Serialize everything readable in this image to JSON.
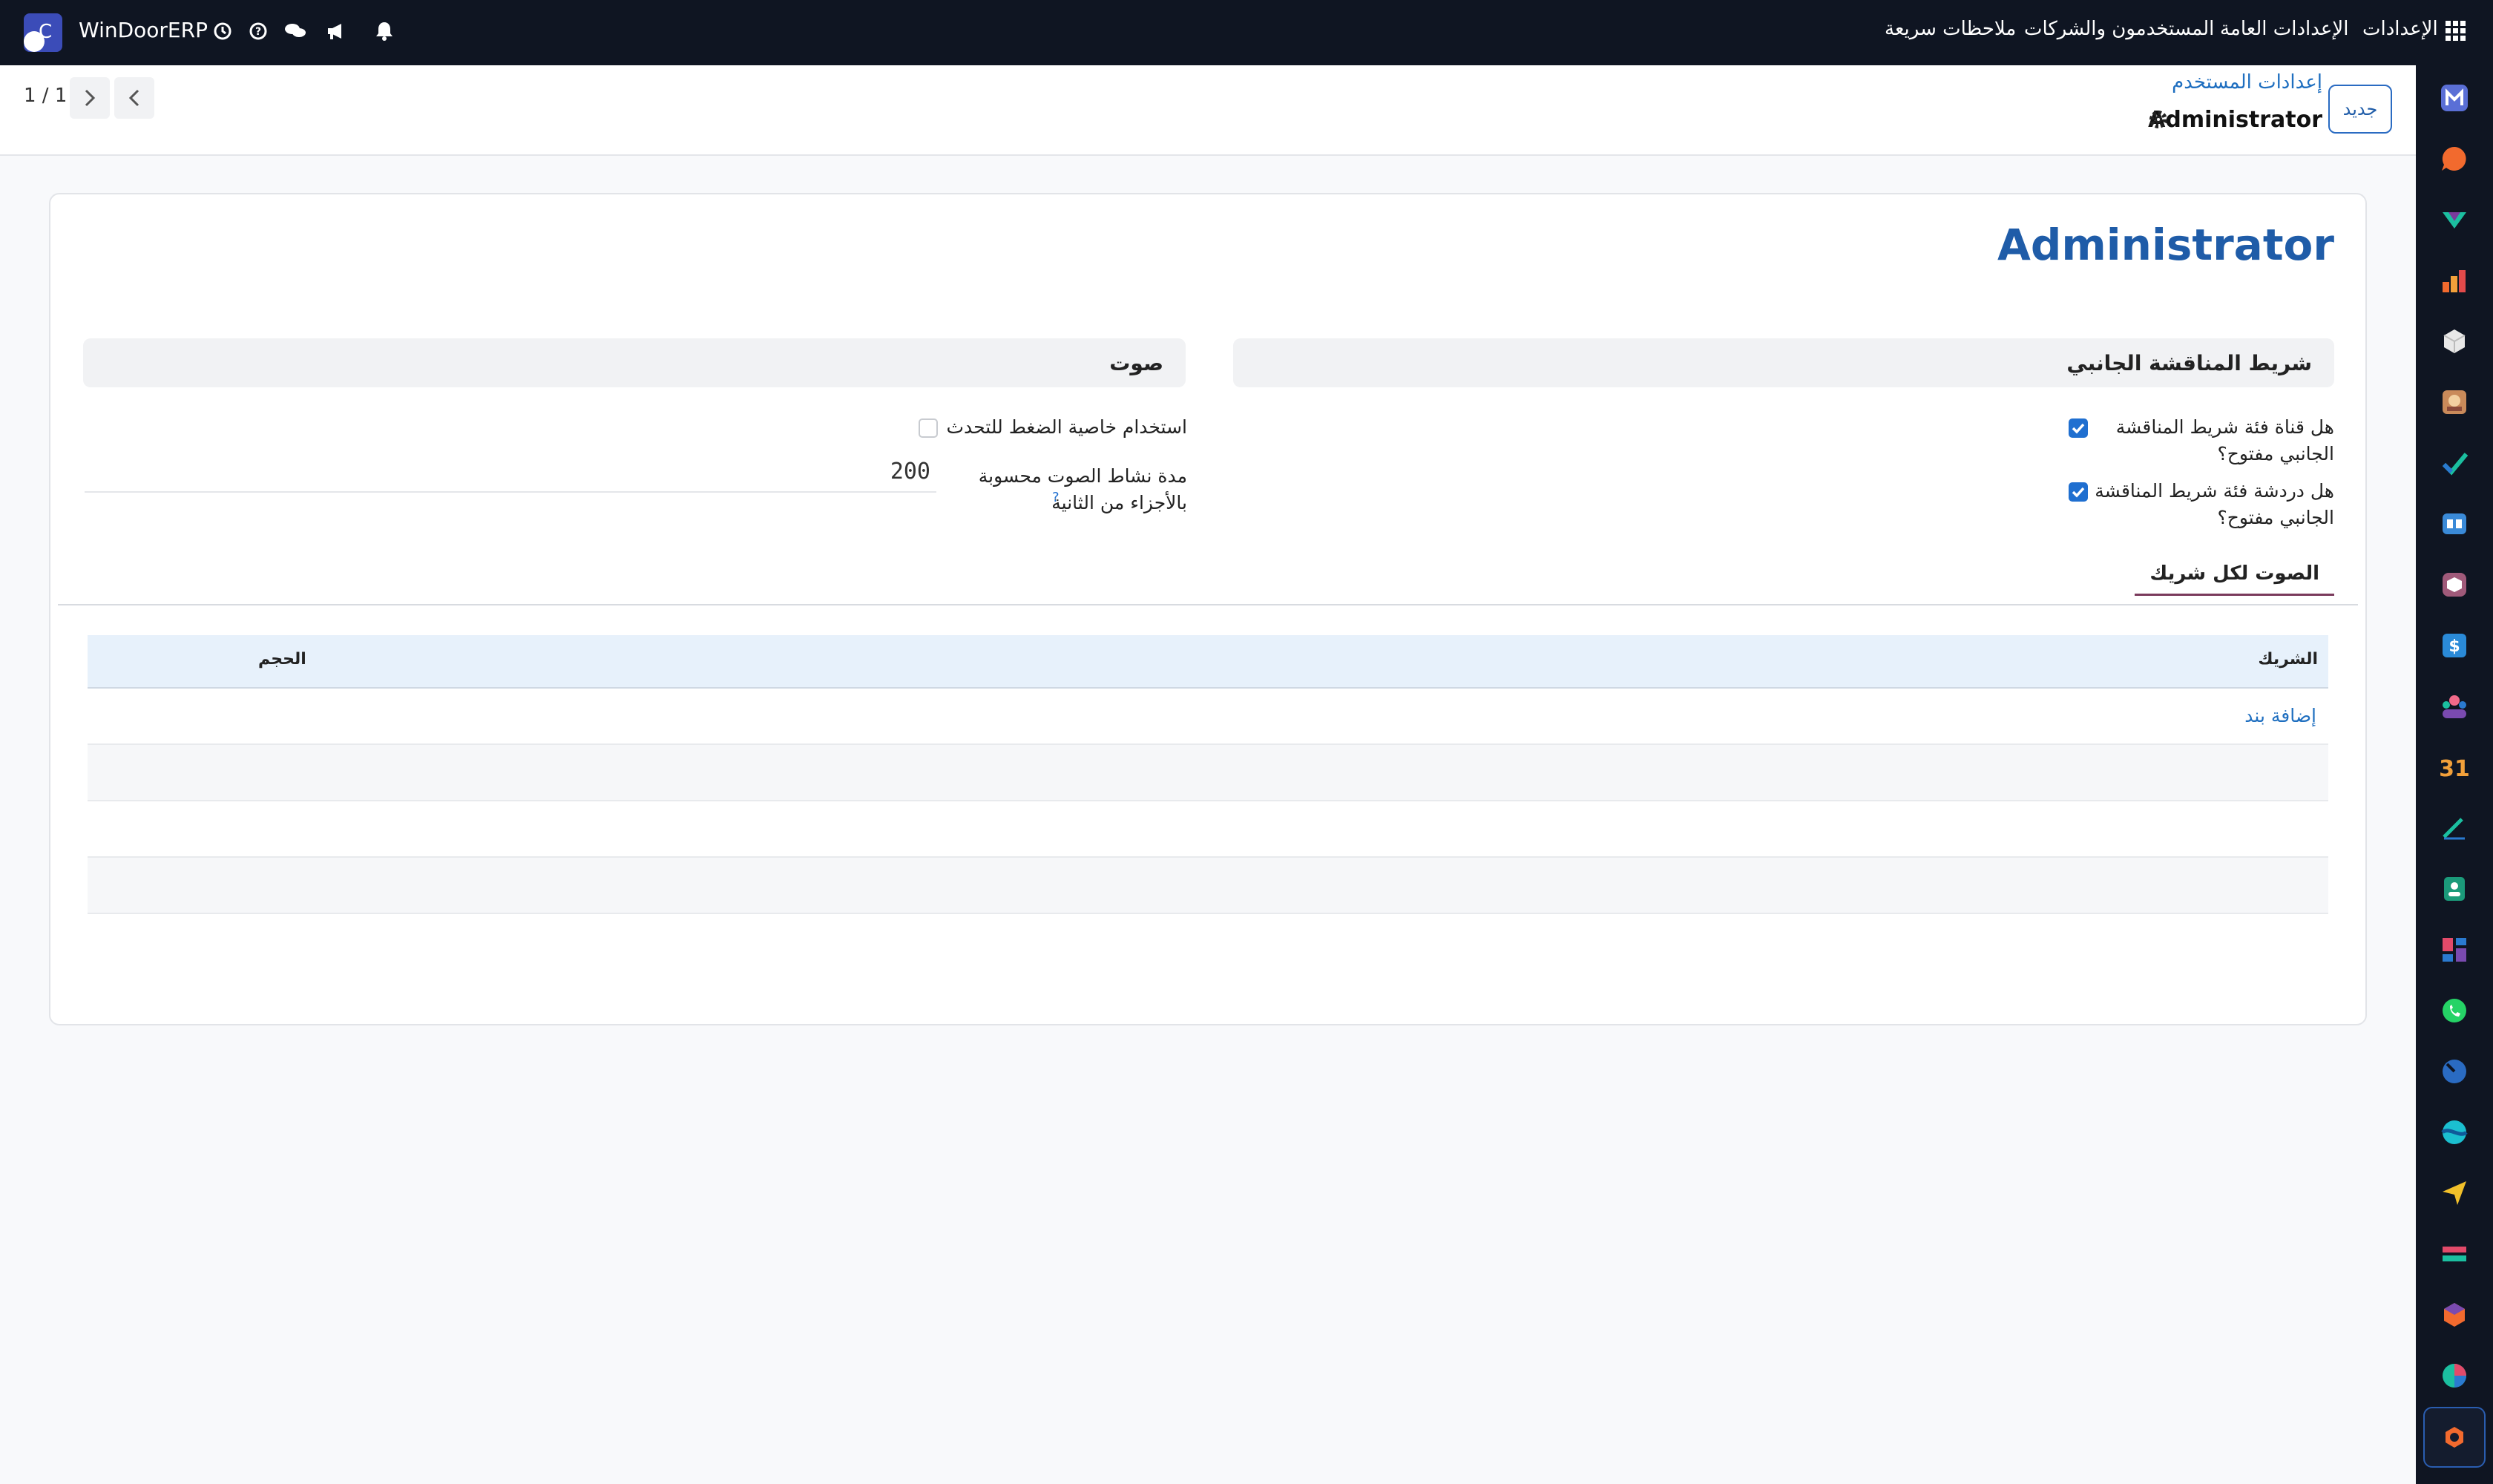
{
  "navbar": {
    "brand": "WinDoorERP",
    "menu": {
      "app": "الإعدادات",
      "general": "الإعدادات العامة",
      "users": "المستخدمون والشركات",
      "notes": "ملاحظات سريعة"
    }
  },
  "control_panel": {
    "pager": "1 / 1",
    "new_button": "جديد",
    "breadcrumb": "إعدادات المستخدم",
    "record_title": "Administrator"
  },
  "form": {
    "title": "Administrator",
    "sidebar_group": {
      "heading": "شريط المناقشة الجانبي",
      "channel_label_1": "هل قناة فئة شريط المناقشة",
      "channel_label_2": "الجانبي مفتوح؟",
      "chat_label_1": "هل دردشة فئة شريط المناقشة",
      "chat_label_2": "الجانبي مفتوح؟",
      "channel_open": true,
      "chat_open": true
    },
    "voice_group": {
      "heading": "صوت",
      "push_to_talk_label": "استخدام خاصية الضغط للتحدث",
      "push_to_talk": false,
      "duration_label_1": "مدة نشاط الصوت محسوبة",
      "duration_label_2": "بالأجزاء من الثانية",
      "duration_value": "200",
      "help_mark": "?"
    },
    "tab": "الصوت لكل شريك",
    "table": {
      "col_partner": "الشريك",
      "col_volume": "الحجم",
      "add_line": "إضافة بند"
    }
  },
  "colors": {
    "navbar": "#0f1522",
    "accent": "#1f5ca8",
    "checkbox": "#1f6fd0"
  }
}
